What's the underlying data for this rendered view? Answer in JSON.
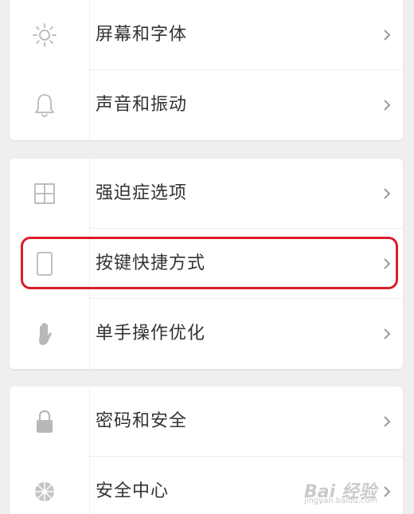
{
  "groups": [
    {
      "items": [
        {
          "label": "屏幕和字体",
          "icon": "sun-icon"
        },
        {
          "label": "声音和振动",
          "icon": "bell-icon"
        }
      ]
    },
    {
      "items": [
        {
          "label": "强迫症选项",
          "icon": "grid-icon"
        },
        {
          "label": "按键快捷方式",
          "icon": "phone-icon"
        },
        {
          "label": "单手操作优化",
          "icon": "hand-icon"
        }
      ]
    },
    {
      "items": [
        {
          "label": "密码和安全",
          "icon": "lock-icon"
        },
        {
          "label": "安全中心",
          "icon": "shield-wheel-icon"
        }
      ]
    }
  ],
  "watermark": {
    "main": "Bai 经验",
    "sub": "jingyan.baidu.com"
  },
  "colors": {
    "background": "#efefef",
    "card": "#ffffff",
    "text": "#333333",
    "icon": "#b8b8b8",
    "highlight": "#d81e2a"
  }
}
